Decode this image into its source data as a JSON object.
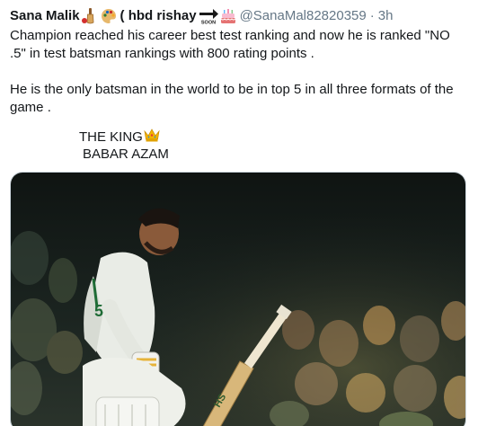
{
  "tweet": {
    "author": {
      "display_name": "Sana Malik",
      "display_name_suffix": "( hbd rishay",
      "handle": "@SanaMal82820359",
      "separator": "·",
      "time": "3h"
    },
    "emojis": {
      "name_1": "cricket-bat-icon",
      "name_2": "artist-palette-icon",
      "name_3": "soon-arrow-icon",
      "name_4": "birthday-cake-icon",
      "text_crown": "crown-icon"
    },
    "lines": {
      "p1": "Champion reached  his career best test ranking and now he is ranked \"NO .5\" in test batsman rankings with 800 rating points .",
      "p2": "He is the only batsman in the world to be in top 5 in all three formats of the game .",
      "king": "THE KING",
      "babar": "BABAR AZAM"
    },
    "media": {
      "description_icon": "cricket-photo"
    }
  },
  "colors": {
    "text": "#14171a",
    "muted": "#657786",
    "border": "#ccd6dd"
  }
}
